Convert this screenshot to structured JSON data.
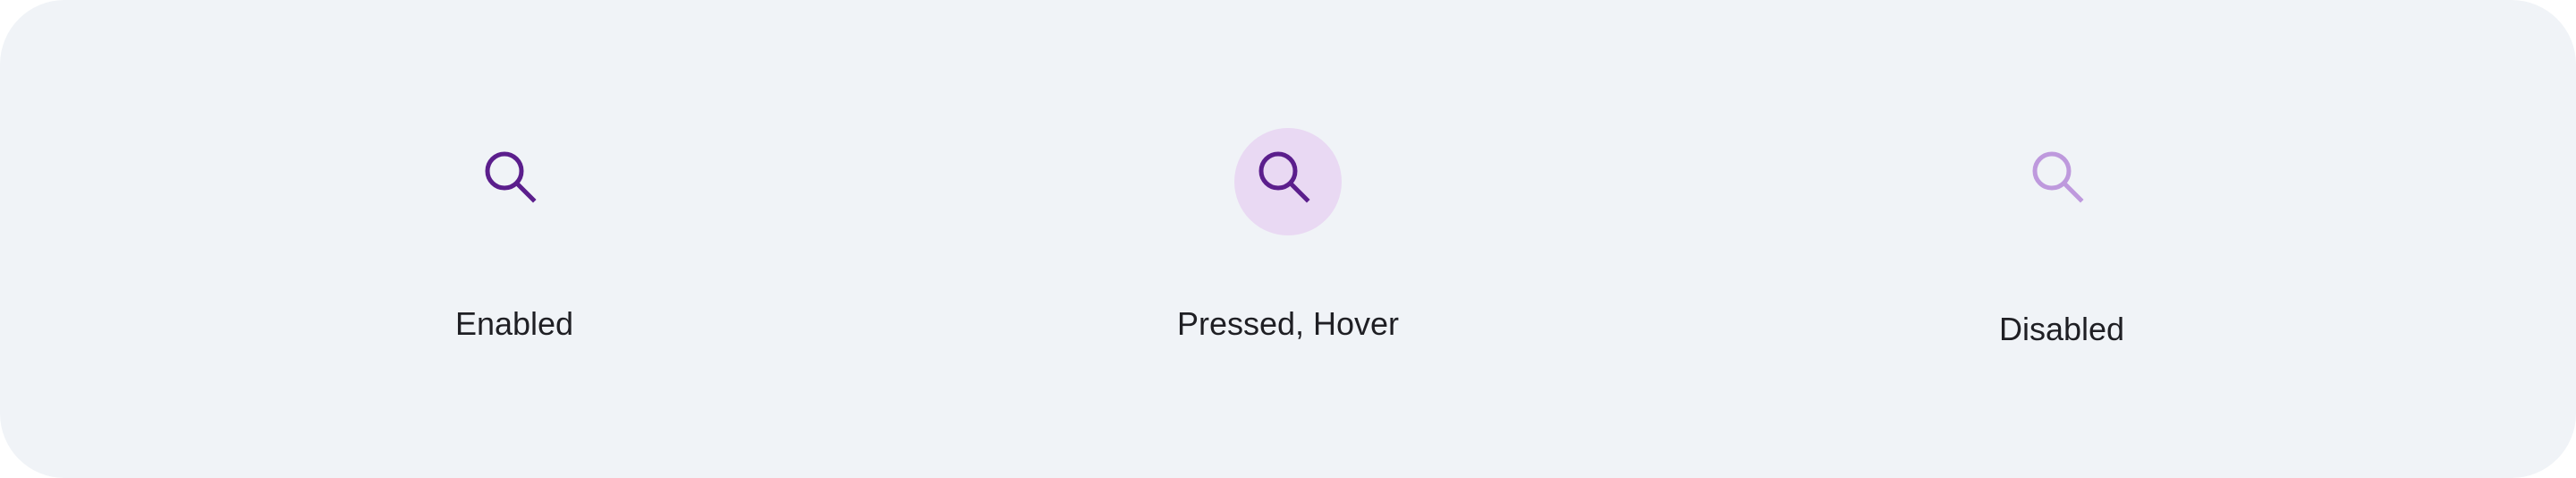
{
  "states": [
    {
      "label": "Enabled",
      "icon": "search-icon",
      "icon_color": "#5B1E8C",
      "state_layer_color": null
    },
    {
      "label": "Pressed, Hover",
      "icon": "search-icon",
      "icon_color": "#5B1E8C",
      "state_layer_color": "#E9D9F3"
    },
    {
      "label": "Disabled",
      "icon": "search-icon",
      "icon_color": "#BE99DD",
      "state_layer_color": null
    }
  ],
  "colors": {
    "panel_background": "#F0F3F7",
    "label_text": "#1F1F24"
  }
}
